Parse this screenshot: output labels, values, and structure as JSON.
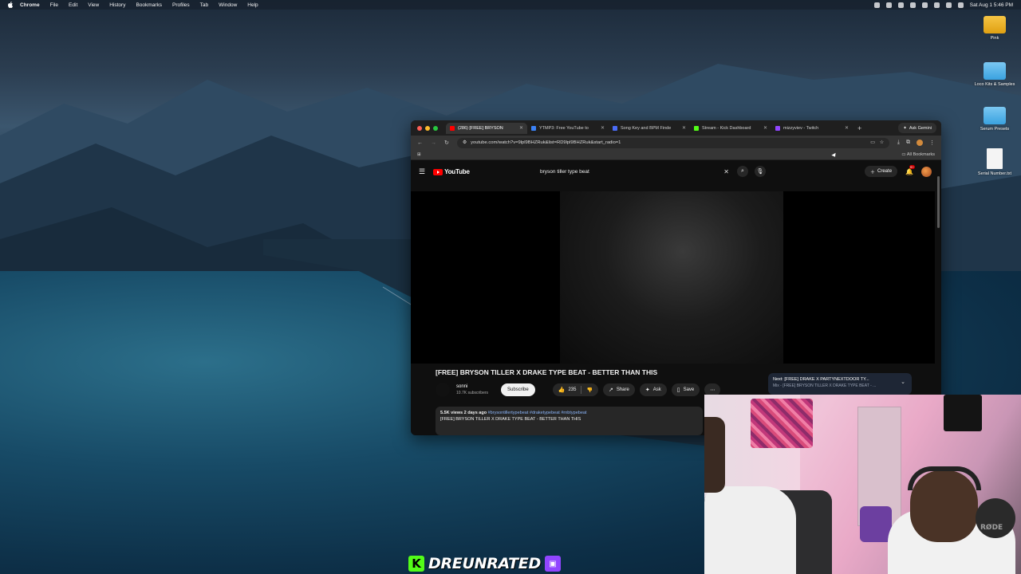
{
  "menubar": {
    "app": "Chrome",
    "items": [
      "File",
      "Edit",
      "View",
      "History",
      "Bookmarks",
      "Profiles",
      "Tab",
      "Window",
      "Help"
    ],
    "clock": "Sat Aug 1  5:46 PM"
  },
  "desktop": {
    "icons": [
      {
        "label": "Pink",
        "type": "folder-gold"
      },
      {
        "label": "Loco Kits & Samples",
        "type": "folder-blue"
      },
      {
        "label": "Serum Presets",
        "type": "folder-blue"
      },
      {
        "label": "Serial Number.txt",
        "type": "doc"
      }
    ]
  },
  "browser": {
    "tabs": [
      {
        "label": "(286) [FREE] BRYSON",
        "color": "#ff0000",
        "active": true
      },
      {
        "label": "YTMP3: Free YouTube to",
        "color": "#3b82f6",
        "active": false
      },
      {
        "label": "Song Key and BPM Finde",
        "color": "#4a6cf7",
        "active": false
      },
      {
        "label": "Stream - Kick Dashboard",
        "color": "#53fc18",
        "active": false
      },
      {
        "label": "mizzyviev - Twitch",
        "color": "#9146ff",
        "active": false
      }
    ],
    "new_tab": "+",
    "ask_label": "Ask Gemini",
    "url": "youtube.com/watch?v=9lpl9BHZRuk&list=RD9lpl9BHZRuk&start_radio=1",
    "all_bookmarks": "All Bookmarks"
  },
  "youtube": {
    "logo": "YouTube",
    "search_query": "bryson tiller type beat",
    "create_label": "Create",
    "notif_count": "9+",
    "video_title": "[FREE] BRYSON TILLER X DRAKE TYPE BEAT - BETTER THAN THIS",
    "channel_name": "sonni",
    "subscribers": "10.7K subscribers",
    "subscribe_label": "Subscribe",
    "likes": "235",
    "share_label": "Share",
    "ask_label": "Ask",
    "save_label": "Save",
    "views_date": "5.5K views  2 days ago",
    "hashtags": "#brysontillertypebeat #draketypebeat #rnbtypebeat",
    "desc_line": "[FREE] BRYSON TILLER X DRAKE TYPE BEAT - BETTER THAN THIS",
    "next_label": "Next: [FREE] DRAKE X PARTYNEXTDOOR TY...",
    "next_sub": "Mix - [FREE] BRYSON TILLER X DRAKE TYPE BEAT - ..."
  },
  "webcam": {
    "mic_brand": "RØDE"
  },
  "overlay": {
    "streamer": "DREUNRATED",
    "kick_letter": "K"
  },
  "colors": {
    "youtube_red": "#ff0000",
    "kick_green": "#53fc18",
    "twitch_purple": "#9146ff"
  }
}
